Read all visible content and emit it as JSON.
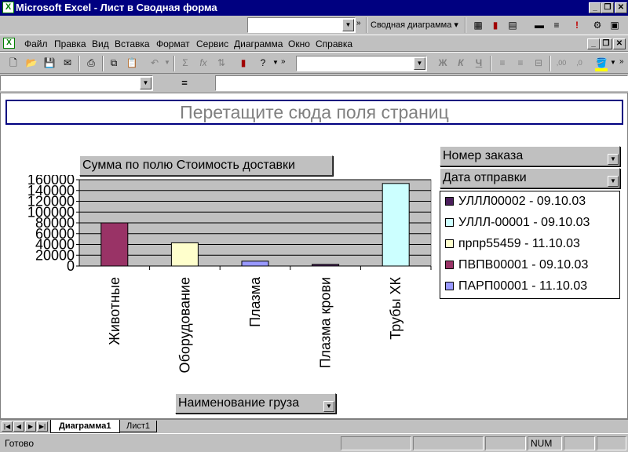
{
  "window": {
    "title": "Microsoft Excel - Лист в Сводная форма",
    "app_icon": "excel-icon"
  },
  "chart_toolbar": {
    "combo_value": "",
    "pivot_chart_label": "Сводная диаграмма"
  },
  "menu": {
    "items": [
      "Файл",
      "Правка",
      "Вид",
      "Вставка",
      "Формат",
      "Сервис",
      "Диаграмма",
      "Окно",
      "Справка"
    ]
  },
  "formula_bar": {
    "name_box": "",
    "equals": "=",
    "content": ""
  },
  "pivot": {
    "page_drop_zone": "Перетащите сюда поля страниц",
    "data_field": "Сумма по полю Стоимость доставки",
    "category_field": "Наименование груза",
    "series_fields": [
      "Номер заказа",
      "Дата отправки"
    ]
  },
  "chart_data": {
    "type": "bar",
    "categories": [
      "Животные",
      "Оборудование",
      "Плазма",
      "Плазма крови",
      "Трубы ХК"
    ],
    "series": [
      {
        "name": "УЛЛЛ00002 - 09.10.03",
        "color": "#4b1f5c",
        "values": [
          0,
          0,
          0,
          3000,
          0
        ]
      },
      {
        "name": "УЛЛЛ-00001 - 09.10.03",
        "color": "#ccffff",
        "values": [
          0,
          0,
          0,
          0,
          153000
        ]
      },
      {
        "name": "прпр55459 - 11.10.03",
        "color": "#ffffcc",
        "values": [
          0,
          43000,
          0,
          0,
          0
        ]
      },
      {
        "name": "ПВПВ00001 - 09.10.03",
        "color": "#993366",
        "values": [
          80000,
          0,
          0,
          0,
          0
        ]
      },
      {
        "name": "ПАРП00001 - 11.10.03",
        "color": "#9999ff",
        "values": [
          0,
          0,
          9000,
          0,
          0
        ]
      }
    ],
    "yticks": [
      "0",
      "20000",
      "40000",
      "60000",
      "80000",
      "100000",
      "120000",
      "140000",
      "160000"
    ],
    "ylim": [
      0,
      160000
    ],
    "grid": true,
    "legend": "right"
  },
  "tabs": {
    "items": [
      "Диаграмма1",
      "Лист1"
    ],
    "active": 0
  },
  "status": {
    "text": "Готово",
    "num": "NUM"
  }
}
